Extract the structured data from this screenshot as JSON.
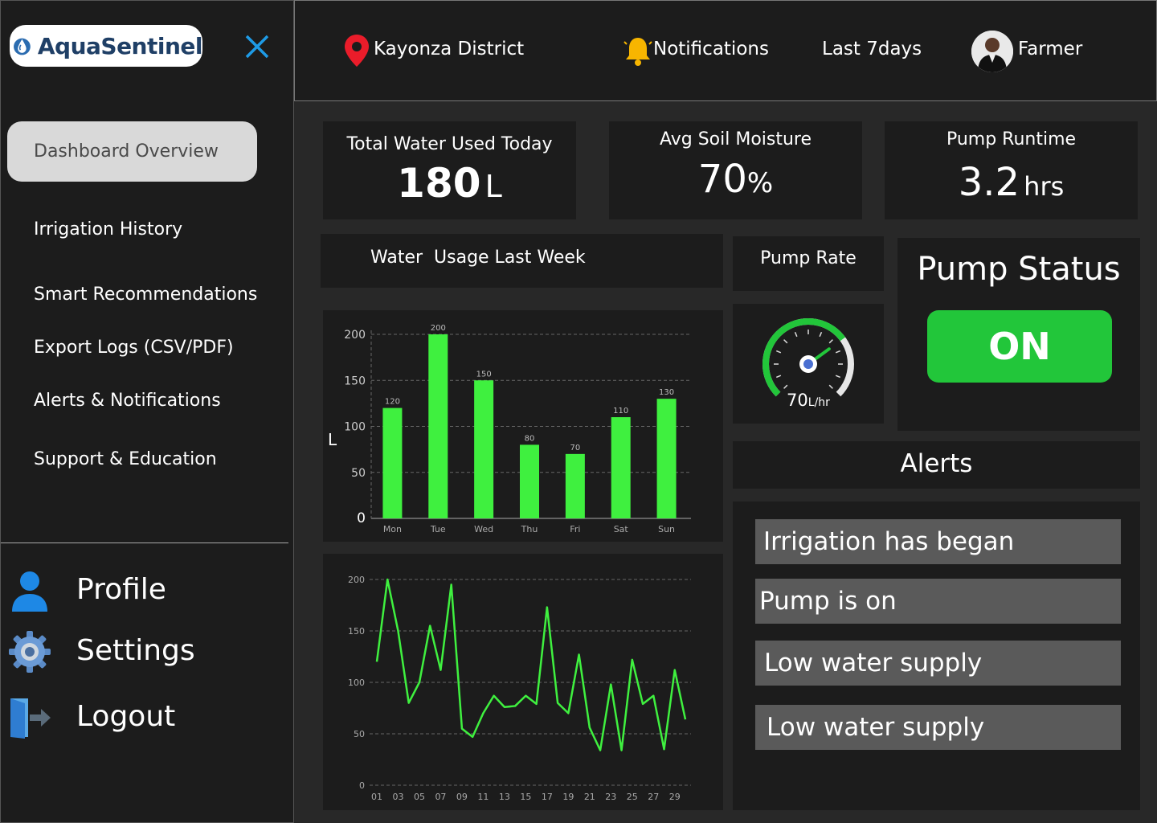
{
  "app": {
    "name": "AquaSentinel"
  },
  "sidebar": {
    "active_item": "Dashboard Overview",
    "items": [
      {
        "label": "Irrigation History"
      },
      {
        "label": "Smart Recommendations"
      },
      {
        "label": "Export Logs (CSV/PDF)"
      },
      {
        "label": "Alerts & Notifications"
      },
      {
        "label": "Support & Education"
      }
    ],
    "bottom": [
      {
        "label": "Profile",
        "icon": "user-icon"
      },
      {
        "label": "Settings",
        "icon": "gear-icon"
      },
      {
        "label": "Logout",
        "icon": "logout-icon"
      }
    ]
  },
  "header": {
    "location": "Kayonza District",
    "notifications": "Notifications",
    "range": "Last 7days",
    "user": "Farmer"
  },
  "stats": {
    "water": {
      "title": "Total Water Used Today",
      "value": "180",
      "unit": "L"
    },
    "moisture": {
      "title": "Avg Soil Moisture",
      "value": "70",
      "unit": "%"
    },
    "runtime": {
      "title": "Pump Runtime",
      "value": "3.2",
      "unit": "hrs"
    }
  },
  "usage_title": "Water  Usage Last Week",
  "pump_rate": {
    "title": "Pump Rate",
    "value": "70",
    "unit": "L/hr",
    "fraction": 0.7
  },
  "pump_status": {
    "title": "Pump Status",
    "state": "ON"
  },
  "alerts": {
    "title": "Alerts",
    "items": [
      "Irrigation has began",
      "Pump is on",
      "Low water supply",
      "Low water supply"
    ]
  },
  "colors": {
    "accent": "#3ff03f",
    "pump_on": "#22c63a",
    "panel": "#1c1c1c",
    "background": "#282828"
  },
  "chart_data": [
    {
      "type": "bar",
      "categories": [
        "Mon",
        "Tue",
        "Wed",
        "Thu",
        "Fri",
        "Sat",
        "Sun"
      ],
      "values": [
        120,
        200,
        150,
        80,
        70,
        110,
        130
      ],
      "ylabel": "L",
      "ylim": [
        0,
        200
      ],
      "yticks": [
        0,
        50,
        100,
        150,
        200
      ],
      "grid": true
    },
    {
      "type": "line",
      "x": [
        1,
        2,
        3,
        4,
        5,
        6,
        7,
        8,
        9,
        10,
        11,
        12,
        13,
        14,
        15,
        16,
        17,
        18,
        19,
        20,
        21,
        22,
        23,
        24,
        25,
        26,
        27,
        28,
        29,
        30
      ],
      "xticks": [
        "01",
        "03",
        "05",
        "07",
        "09",
        "11",
        "13",
        "15",
        "17",
        "19",
        "21",
        "23",
        "25",
        "27",
        "29"
      ],
      "values": [
        120,
        200,
        150,
        80,
        100,
        155,
        112,
        195,
        55,
        47,
        70,
        87,
        76,
        77,
        87,
        79,
        173,
        80,
        70,
        127,
        56,
        34,
        98,
        34,
        122,
        79,
        87,
        35,
        112,
        64
      ],
      "ylim": [
        0,
        200
      ],
      "yticks": [
        0,
        50,
        100,
        150,
        200
      ],
      "grid": true
    }
  ]
}
